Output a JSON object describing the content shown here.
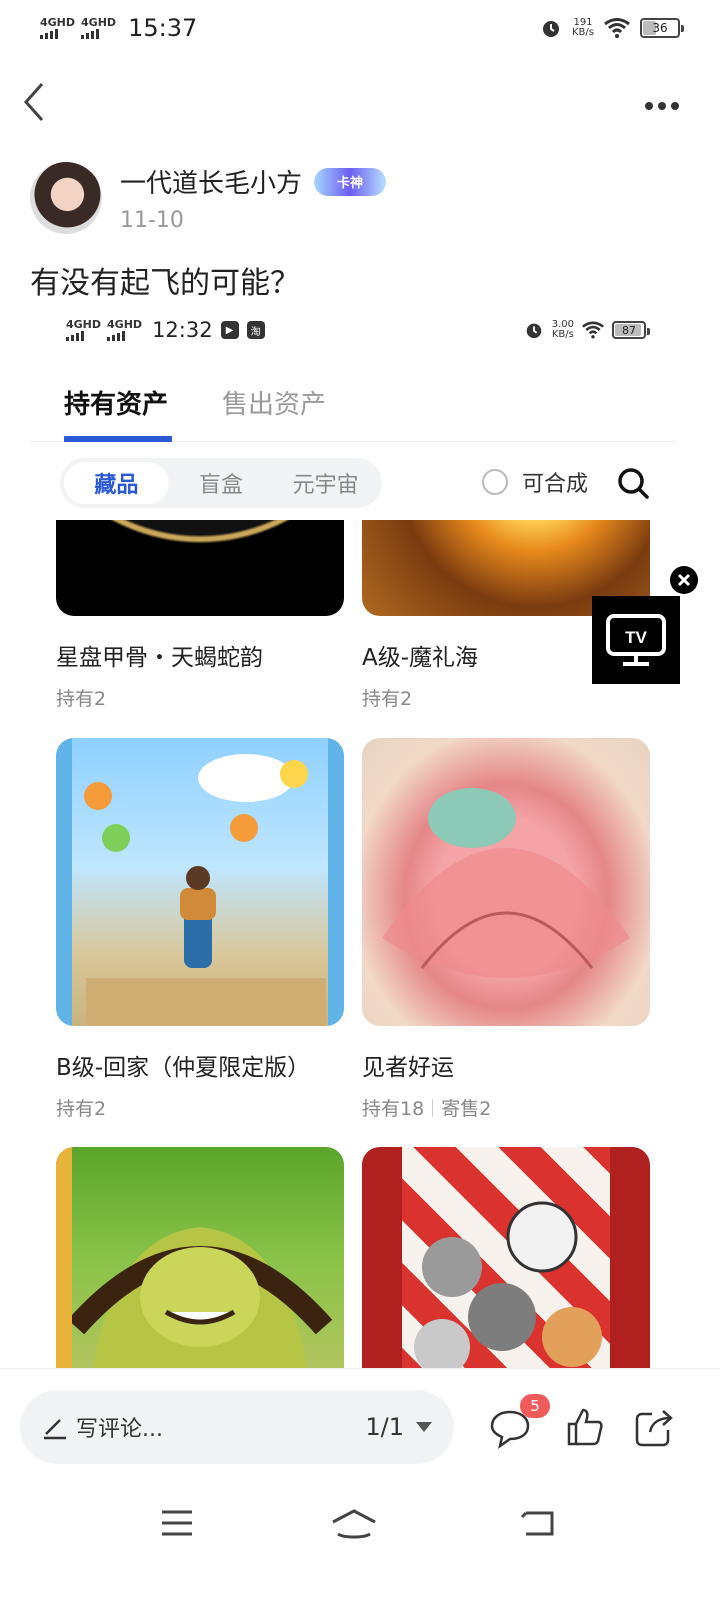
{
  "status_bar": {
    "signal_1": "4GHD",
    "signal_2": "4GHD",
    "time": "15:37",
    "speed_value": "191",
    "speed_unit": "KB/s",
    "battery": "36",
    "battery_level": 0.36
  },
  "post": {
    "author_name": "一代道长毛小方",
    "badge": "卡神",
    "date": "11-10",
    "title": "有没有起飞的可能？"
  },
  "embedded": {
    "status_bar": {
      "signal_1": "4GHD",
      "signal_2": "4GHD",
      "time": "12:32",
      "speed_value": "3.00",
      "speed_unit": "KB/s",
      "battery": "87",
      "battery_level": 0.87
    },
    "tabs": [
      {
        "label": "持有资产",
        "active": true
      },
      {
        "label": "售出资产",
        "active": false
      }
    ],
    "filters": [
      "藏品",
      "盲盒",
      "元宇宙"
    ],
    "combine_label": "可合成",
    "cards": [
      {
        "title": "星盘甲骨・天蝎蛇韵",
        "hold": "持有2"
      },
      {
        "title": "A级-魔礼海",
        "hold": "持有2"
      },
      {
        "title": "B级-回家（仲夏限定版）",
        "hold": "持有2"
      },
      {
        "title": "见者好运",
        "hold": "持有18",
        "consign": "寄售2"
      }
    ]
  },
  "floating": {
    "tv_label": "TV"
  },
  "bottom": {
    "comment_placeholder": "写评论...",
    "page_indicator": "1/1",
    "comment_count": "5"
  },
  "icons": {
    "back": "chevron-left-icon",
    "more": "more-dots-icon",
    "search": "search-icon",
    "comment": "comment-bubble-icon",
    "like": "thumbs-up-icon",
    "share": "share-icon"
  }
}
